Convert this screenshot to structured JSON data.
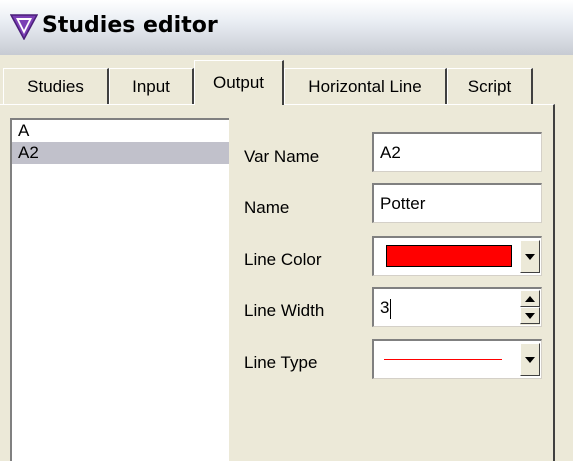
{
  "window": {
    "title": "Studies editor",
    "icon": "tradestation-v-icon"
  },
  "tabs": [
    {
      "label": "Studies",
      "active": false
    },
    {
      "label": "Input",
      "active": false
    },
    {
      "label": "Output",
      "active": true
    },
    {
      "label": "Horizontal Line",
      "active": false
    },
    {
      "label": "Script",
      "active": false
    }
  ],
  "output_list": {
    "items": [
      "A",
      "A2"
    ],
    "selected": "A2"
  },
  "form": {
    "var_name_label": "Var Name",
    "var_name_value": "A2",
    "name_label": "Name",
    "name_value": "Potter",
    "line_color_label": "Line Color",
    "line_color_value": "#ff0000",
    "line_width_label": "Line Width",
    "line_width_value": "3",
    "line_type_label": "Line Type",
    "line_type_value": "solid"
  }
}
